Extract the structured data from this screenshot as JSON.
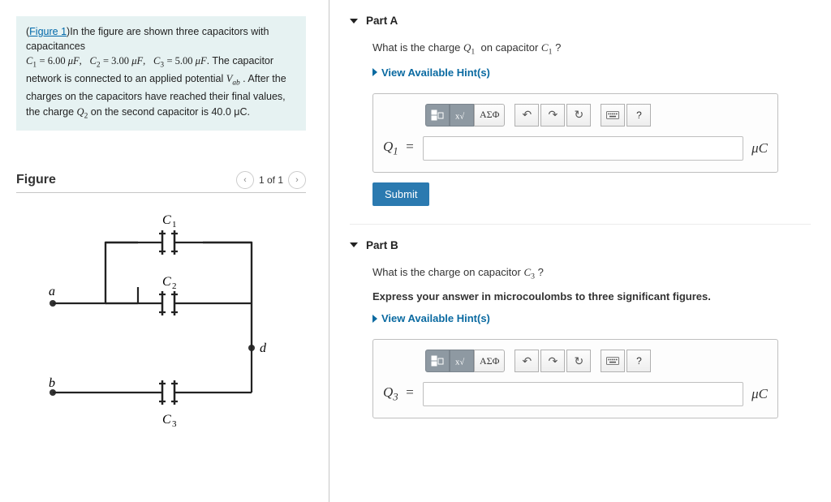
{
  "problem": {
    "figure_link": "Figure 1",
    "intro": "In the figure are shown three capacitors with capacitances",
    "caps_line_prefix": "C₁ = 6.00 μF,  C₂ = 3.00 μF,  C₃ = 5.00 μF",
    "tail1": ". The capacitor network is connected to an applied potential ",
    "vab": "V",
    "vab_sub": "ab",
    "tail2": " . After the charges on the capacitors have reached their final values, the charge ",
    "q2": "Q₂",
    "tail3": " on the second capacitor is 40.0 μC."
  },
  "figure": {
    "title": "Figure",
    "pager": "1 of 1",
    "labels": {
      "a": "a",
      "b": "b",
      "d": "d",
      "c1": "C₁",
      "c2": "C₂",
      "c3": "C₃"
    }
  },
  "parts": {
    "A": {
      "heading": "Part A",
      "question": "What is the charge Q₁ on capacitor C₁ ?",
      "hints": "View Available Hint(s)",
      "lhs": "Q₁ =",
      "unit": "μC",
      "submit": "Submit"
    },
    "B": {
      "heading": "Part B",
      "question": "What is the charge on capacitor C₃ ?",
      "instruction": "Express your answer in microcoulombs to three significant figures.",
      "hints": "View Available Hint(s)",
      "lhs": "Q₃ =",
      "unit": "μC"
    }
  },
  "toolbar": {
    "fraction_tip": "template",
    "sqrt_tip": "radical/exponent",
    "greek": "ΑΣΦ",
    "undo": "undo",
    "redo": "redo",
    "reset": "reset",
    "keyboard": "keyboard",
    "help": "?"
  },
  "chart_data": {
    "type": "diagram",
    "description": "Circuit diagram: terminals a (top) and b (bottom) on the left. C1 and C2 are in parallel between the top rail and an internal node d on the right; C3 connects node d (via bottom rail) back to terminal b. (C1 ∥ C2) in series with C3 across V_ab.",
    "components": [
      {
        "name": "C1",
        "value_uF": 6.0,
        "between": [
          "top-rail",
          "node-d"
        ]
      },
      {
        "name": "C2",
        "value_uF": 3.0,
        "between": [
          "top-rail",
          "node-d"
        ]
      },
      {
        "name": "C3",
        "value_uF": 5.0,
        "between": [
          "bottom-rail-left",
          "bottom-rail-right"
        ]
      }
    ],
    "terminals": [
      "a",
      "b"
    ],
    "given": {
      "Q2_uC": 40.0
    }
  }
}
